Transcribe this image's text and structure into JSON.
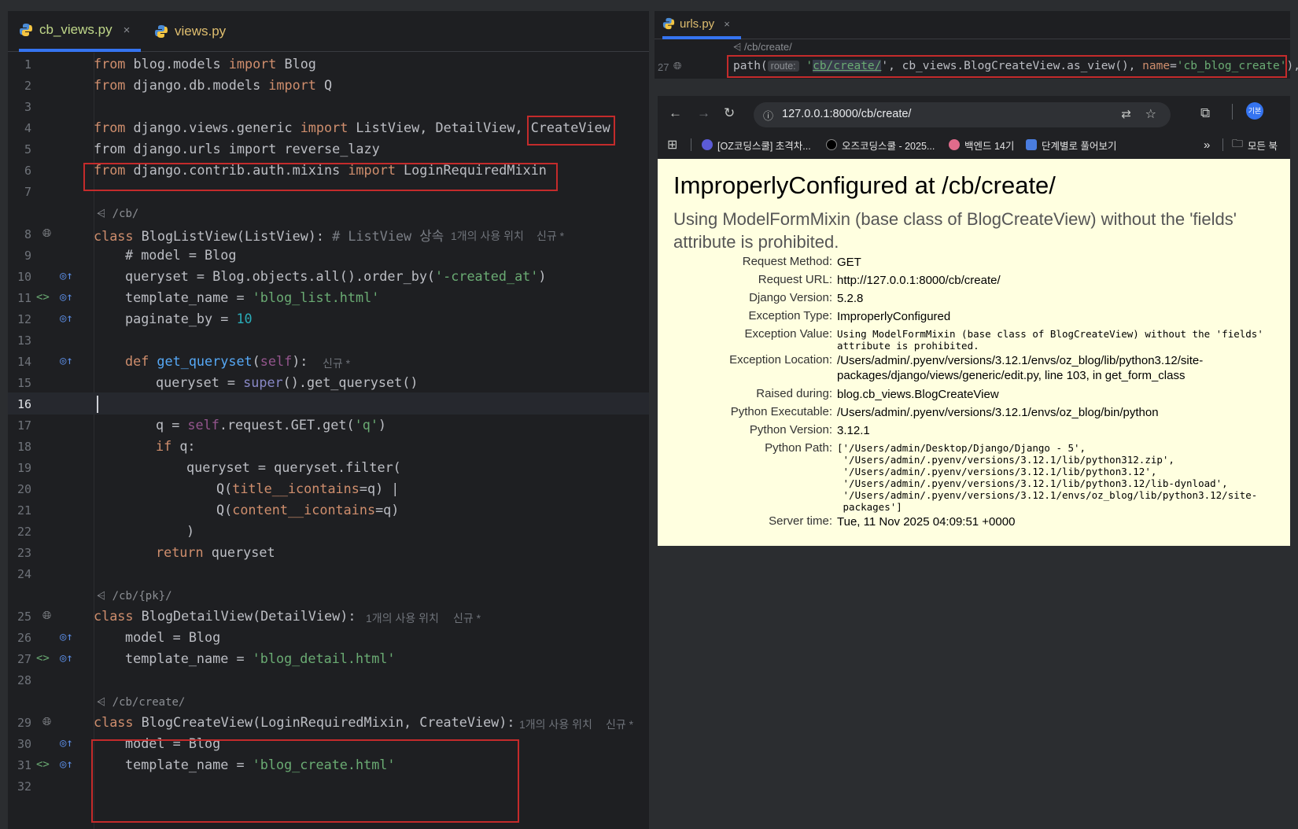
{
  "editor": {
    "tabs": [
      {
        "label": "cb_views.py",
        "active": true
      },
      {
        "label": "views.py",
        "active": false
      }
    ],
    "close_glyph": "×",
    "inlay_routes": {
      "list": "/cb/",
      "detail": "/cb/{pk}/",
      "create": "/cb/create/"
    },
    "hints": {
      "usage": "1개의 사용 위치",
      "new": "신규 *",
      "inherit": "# ListView 상속"
    },
    "line_numbers": [
      "1",
      "2",
      "3",
      "4",
      "5",
      "6",
      "7",
      "8",
      "9",
      "10",
      "11",
      "12",
      "13",
      "14",
      "15",
      "16",
      "17",
      "18",
      "19",
      "20",
      "21",
      "22",
      "23",
      "24",
      "25",
      "26",
      "27",
      "28",
      "29",
      "30",
      "31",
      "32"
    ],
    "code": {
      "l1": {
        "a": "from",
        "b": " blog.models ",
        "c": "import",
        "d": " Blog"
      },
      "l2": {
        "a": "from",
        "b": " django.db.models ",
        "c": "import",
        "d": " Q"
      },
      "l4": {
        "a": "from",
        "b": " django.views.generic ",
        "c": "import",
        "d": " ListView, DetailView, ",
        "e": "CreateView"
      },
      "l5": "from django.urls import reverse_lazy",
      "l6": {
        "a": "from",
        "b": " django.contrib.auth.mixins ",
        "c": "import",
        "d": " LoginRequiredMixin"
      },
      "l8": {
        "a": "class",
        "b": " BlogListView(ListView): "
      },
      "l9": "# model = Blog",
      "l10": {
        "a": "queryset = Blog.objects.all().order_by(",
        "b": "'-created_at'",
        "c": ")"
      },
      "l11": {
        "a": "template_name = ",
        "b": "'blog_list.html'"
      },
      "l12": {
        "a": "paginate_by = ",
        "b": "10"
      },
      "l14": {
        "a": "def",
        "b": " get_queryset",
        "c": "(",
        "d": "self",
        "e": "):"
      },
      "l15": {
        "a": "queryset = ",
        "b": "super",
        "c": "().get_queryset()"
      },
      "l17": {
        "a": "q = ",
        "b": "self",
        "c": ".request.GET.get(",
        "d": "'q'",
        "e": ")"
      },
      "l18": {
        "a": "if",
        "b": " q:"
      },
      "l19": "queryset = queryset.filter(",
      "l20": {
        "a": "Q(",
        "b": "title__icontains",
        "c": "=q) |"
      },
      "l21": {
        "a": "Q(",
        "b": "content__icontains",
        "c": "=q)"
      },
      "l22": ")",
      "l23": {
        "a": "return",
        "b": " queryset"
      },
      "l25": {
        "a": "class",
        "b": " BlogDetailView(DetailView):"
      },
      "l26": "model = Blog",
      "l27": {
        "a": "template_name = ",
        "b": "'blog_detail.html'"
      },
      "l29": {
        "a": "class",
        "b": " BlogCreateView(LoginRequiredMixin, CreateView):"
      },
      "l30": "model = Blog",
      "l31": {
        "a": "template_name = ",
        "b": "'blog_create.html'"
      }
    }
  },
  "urls_pane": {
    "tab": "urls.py",
    "route": "/cb/create/",
    "line_number": "27",
    "code": {
      "a": "path(",
      "inlay": "route:",
      "b": "'",
      "c": "cb/create/",
      "d": "', cb_views.BlogCreateView.as_view(), ",
      "e": "name",
      "f": "=",
      "g": "'cb_blog_create'",
      "h": "),"
    }
  },
  "browser": {
    "url": "127.0.0.1:8000/cb/create/",
    "bookmarks": [
      {
        "label": "[OZ코딩스쿨] 초격차...",
        "color": "#5b5bd6"
      },
      {
        "label": "오즈코딩스쿨 - 2025...",
        "color": "#000000"
      },
      {
        "label": "백엔드 14기",
        "color": "#e06b8b"
      },
      {
        "label": "단계별로 풀어보기",
        "color": "#4a7de0"
      }
    ],
    "all_bookmarks": "모든 북",
    "overflow": "»",
    "profile": "기본",
    "error": {
      "title": "ImproperlyConfigured at /cb/create/",
      "subtitle": "Using ModelFormMixin (base class of BlogCreateView) without the 'fields' attribute is prohibited.",
      "rows": [
        {
          "key": "Request Method:",
          "value": "GET"
        },
        {
          "key": "Request URL:",
          "value": "http://127.0.0.1:8000/cb/create/"
        },
        {
          "key": "Django Version:",
          "value": "5.2.8"
        },
        {
          "key": "Exception Type:",
          "value": "ImproperlyConfigured"
        },
        {
          "key": "Exception Value:",
          "value": "Using ModelFormMixin (base class of BlogCreateView) without the 'fields'\nattribute is prohibited."
        },
        {
          "key": "Exception Location:",
          "value": "/Users/admin/.pyenv/versions/3.12.1/envs/oz_blog/lib/python3.12/site-packages/django/views/generic/edit.py, line 103, in get_form_class"
        },
        {
          "key": "Raised during:",
          "value": "blog.cb_views.BlogCreateView"
        },
        {
          "key": "Python Executable:",
          "value": "/Users/admin/.pyenv/versions/3.12.1/envs/oz_blog/bin/python"
        },
        {
          "key": "Python Version:",
          "value": "3.12.1"
        },
        {
          "key": "Python Path:",
          "value": "['/Users/admin/Desktop/Django/Django - 5',\n '/Users/admin/.pyenv/versions/3.12.1/lib/python312.zip',\n '/Users/admin/.pyenv/versions/3.12.1/lib/python3.12',\n '/Users/admin/.pyenv/versions/3.12.1/lib/python3.12/lib-dynload',\n '/Users/admin/.pyenv/versions/3.12.1/envs/oz_blog/lib/python3.12/site-\n packages']"
        },
        {
          "key": "Server time:",
          "value": "Tue, 11 Nov 2025 04:09:51 +0000"
        }
      ]
    }
  },
  "colors": {
    "highlight_box": "#c42b2b",
    "accent": "#3574f0",
    "error_bg": "#ffffe0"
  }
}
